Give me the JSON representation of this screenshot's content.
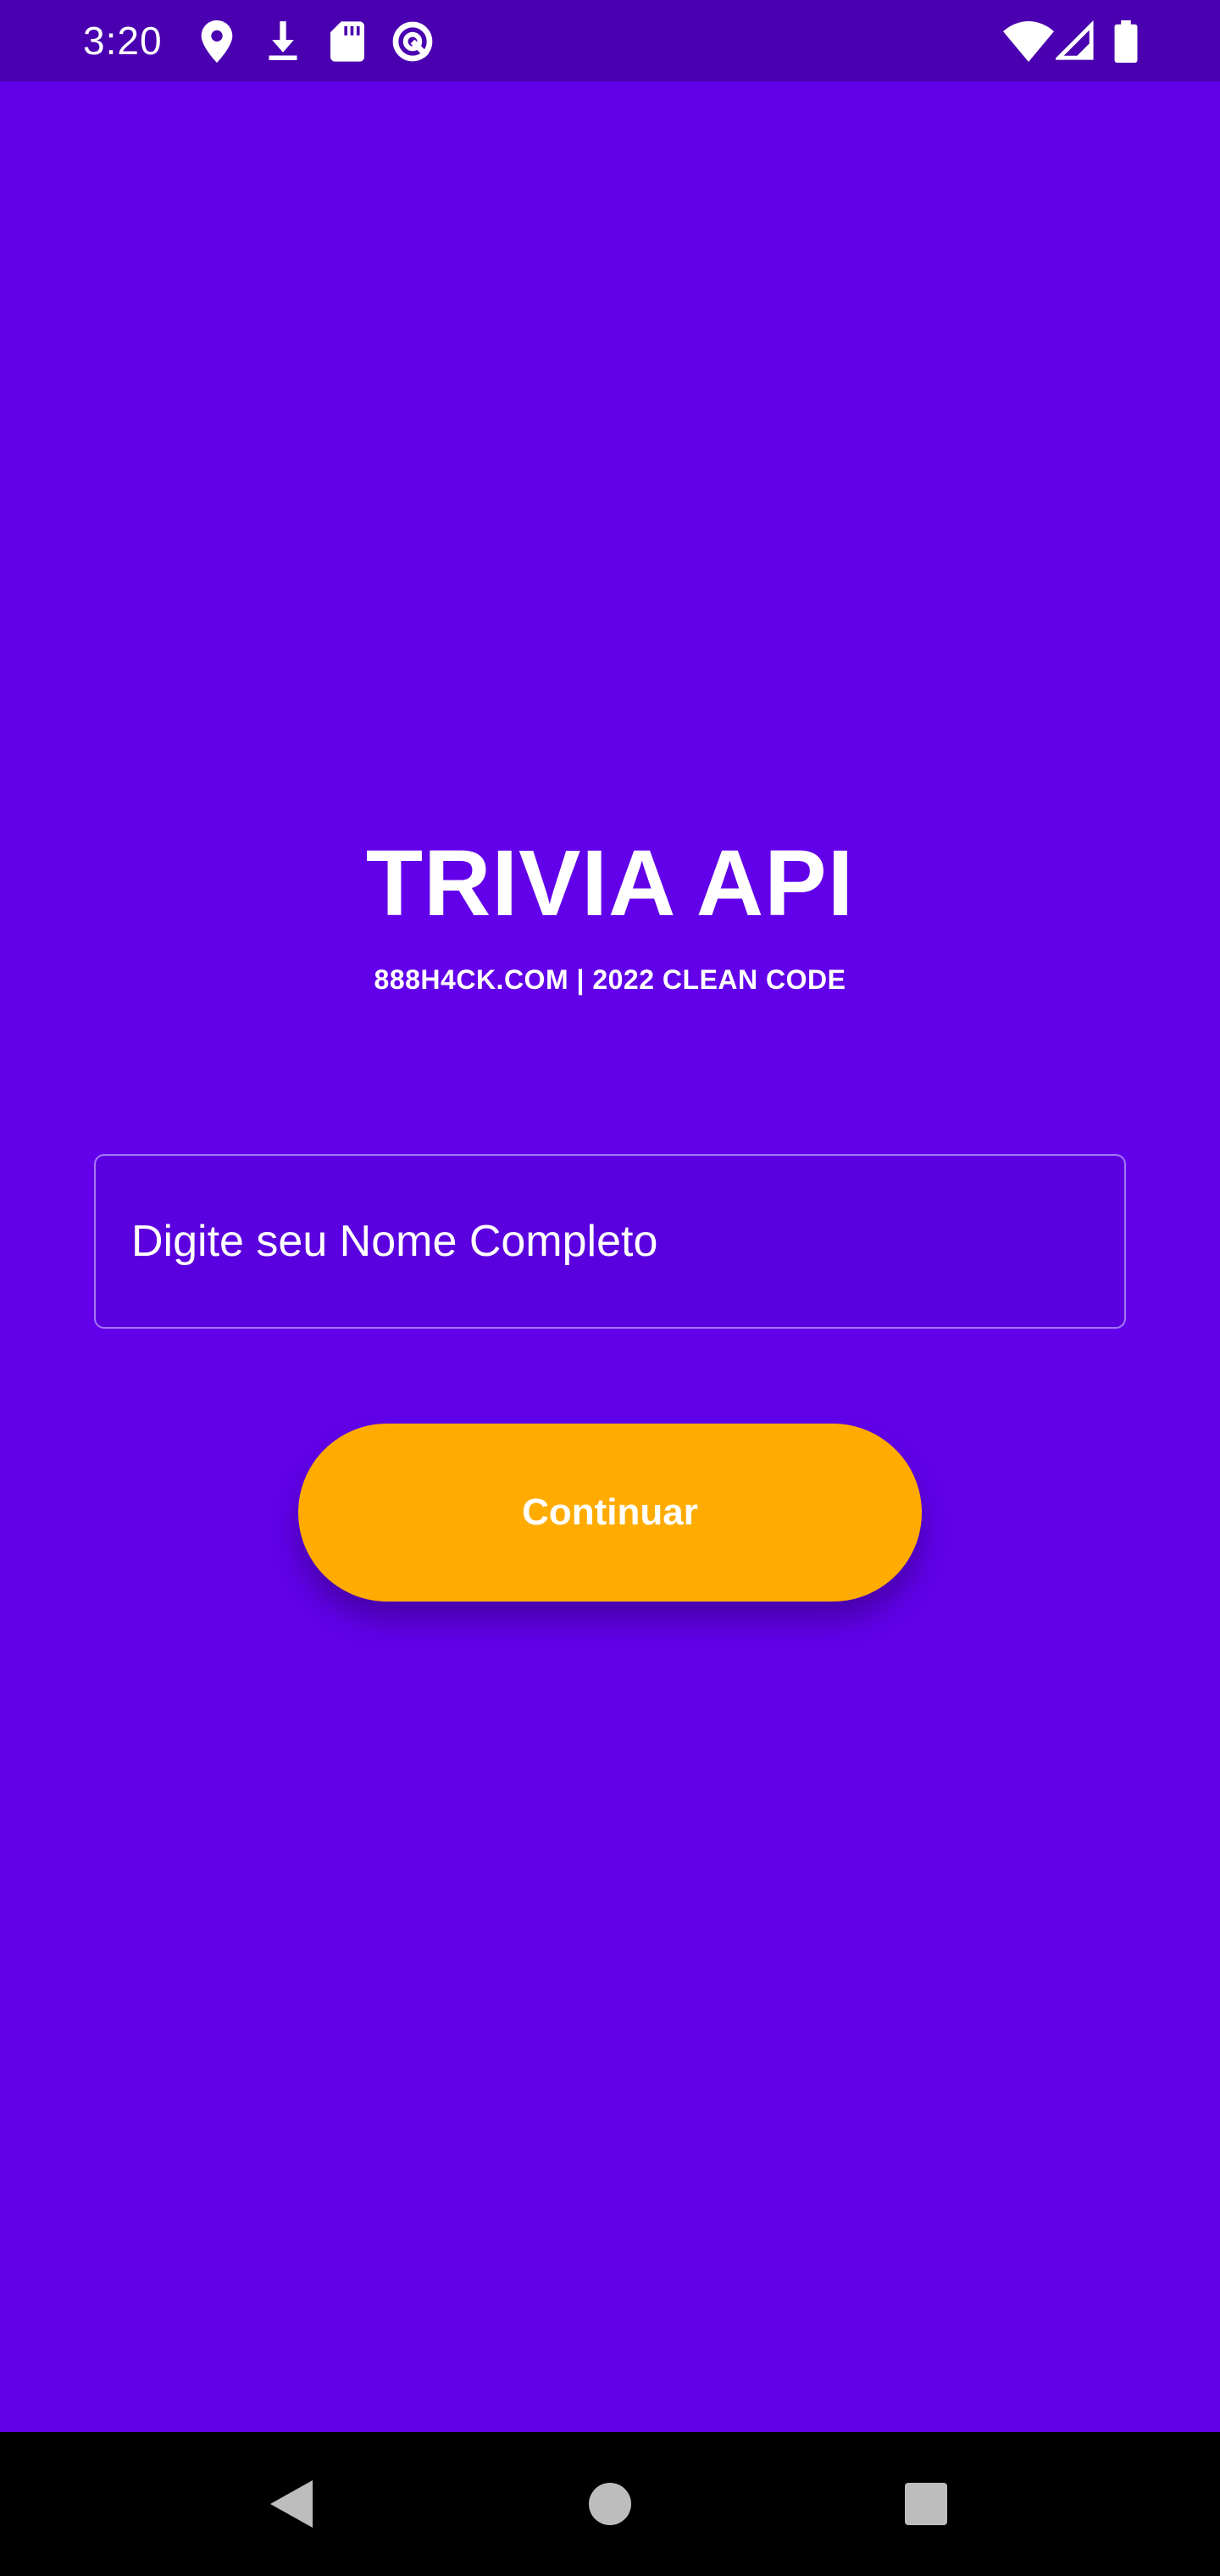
{
  "status_bar": {
    "time": "3:20",
    "left_icons": [
      "location-icon",
      "download-icon",
      "sd-card-icon",
      "data-saver-icon"
    ],
    "right_icons": [
      "wifi-icon",
      "cellular-signal-icon",
      "battery-icon"
    ]
  },
  "main": {
    "title": "TRIVIA API",
    "subtitle": "888H4CK.COM | 2022 CLEAN CODE",
    "name_input": {
      "placeholder": "Digite seu Nome Completo",
      "value": ""
    },
    "continue_label": "Continuar"
  },
  "nav_bar": {
    "buttons": [
      "back-icon",
      "home-icon",
      "recents-icon"
    ]
  },
  "colors": {
    "background": "#6200EA",
    "status_bar": "#4A00B0",
    "button": "#FFAB00",
    "text": "#FFFFFF",
    "nav_bar": "#000000"
  }
}
